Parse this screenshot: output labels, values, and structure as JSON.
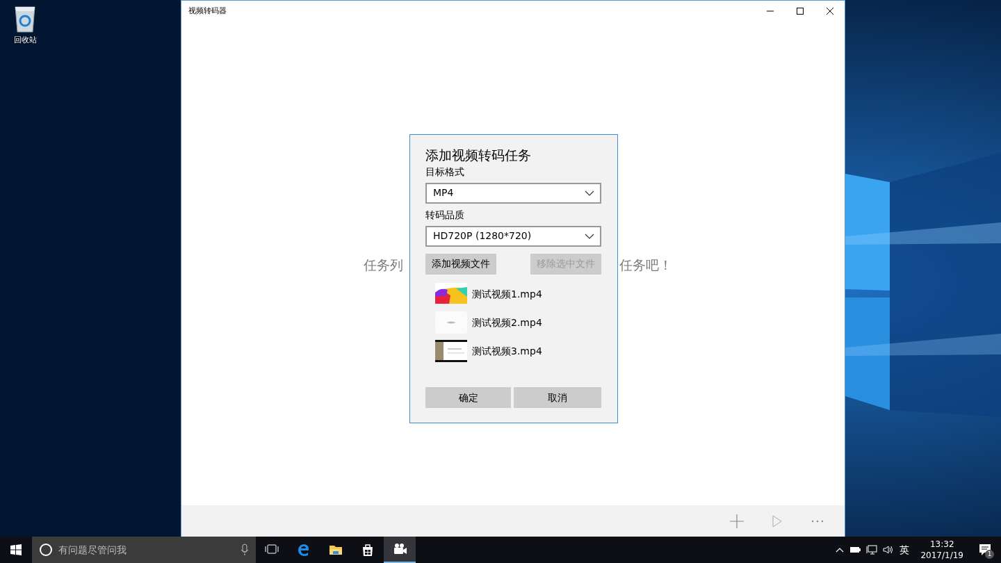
{
  "desktop": {
    "icons": [
      {
        "label": "回收站"
      }
    ]
  },
  "window": {
    "title": "视频转码器",
    "empty_message_left": "任务列",
    "empty_message_right": "任务吧！"
  },
  "dialog": {
    "title": "添加视频转码任务",
    "format_label": "目标格式",
    "format_value": "MP4",
    "quality_label": "转码品质",
    "quality_value": "HD720P (1280*720)",
    "add_button": {
      "label": "添加视频文件",
      "disabled": false
    },
    "remove_button": {
      "label": "移除选中文件",
      "disabled": true
    },
    "files": [
      {
        "name": "测试视频1.mp4"
      },
      {
        "name": "测试视频2.mp4"
      },
      {
        "name": "测试视频3.mp4"
      }
    ],
    "ok_button": "确定",
    "cancel_button": "取消"
  },
  "taskbar": {
    "search_placeholder": "有问题尽管问我",
    "apps": [
      {
        "kind": "taskview",
        "selected": false
      },
      {
        "kind": "browser",
        "selected": false
      },
      {
        "kind": "folder",
        "selected": false
      },
      {
        "kind": "store",
        "selected": false
      },
      {
        "kind": "camera",
        "selected": true
      }
    ],
    "ime": "英",
    "time": "13:32",
    "date": "2017/1/19",
    "notification_count": "1"
  }
}
